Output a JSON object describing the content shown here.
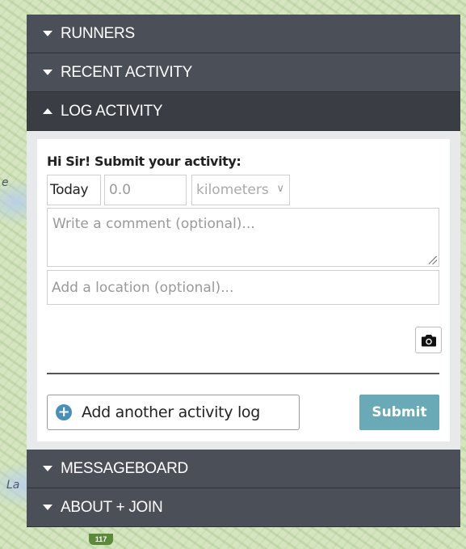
{
  "map": {
    "left_label": "e",
    "bottom_label": "La",
    "route_shield": "117"
  },
  "sections": {
    "runners": "RUNNERS",
    "recent_activity": "RECENT ACTIVITY",
    "log_activity": "LOG ACTIVITY",
    "messageboard": "MESSAGEBOARD",
    "about_join": "ABOUT + JOIN"
  },
  "log_form": {
    "greeting": "Hi Sir! Submit your activity:",
    "date_value": "Today",
    "distance_placeholder": "0.0",
    "unit_selected": "kilometers",
    "comment_placeholder": "Write a comment (optional)...",
    "location_placeholder": "Add a location (optional)...",
    "camera_icon": "camera-icon",
    "add_another_label": "Add another activity log",
    "submit_label": "Submit"
  },
  "colors": {
    "panel_header": "#4b4f57",
    "panel_header_active": "#3a3d43",
    "submit_button": "#6aaab7",
    "add_icon": "#4a8fb8"
  }
}
